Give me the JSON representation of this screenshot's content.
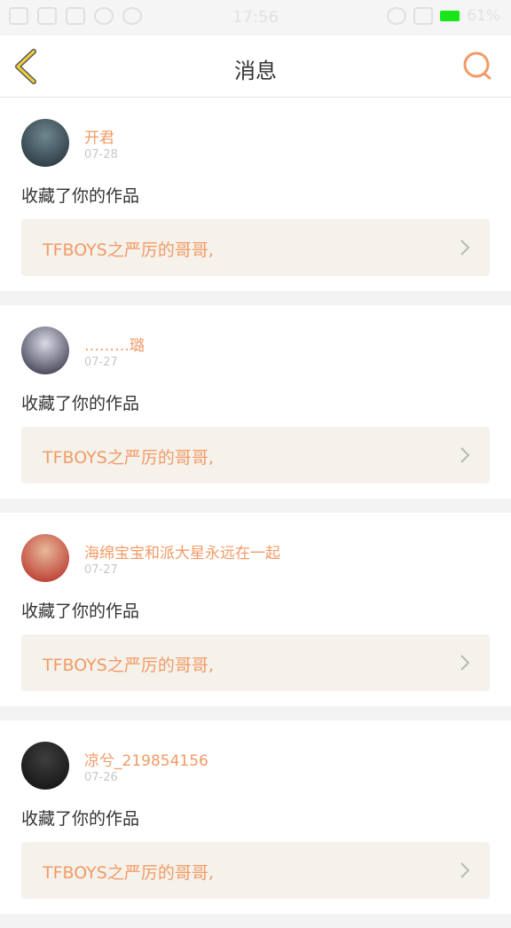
{
  "status_bar": {
    "time": "17:56",
    "battery_percent": "61%",
    "icons_left": [
      "usb-icon",
      "signal-icon",
      "image-icon",
      "shield-icon",
      "broadcast-icon"
    ],
    "icons_right": [
      "hotspot-icon",
      "wifi-icon",
      "battery-icon"
    ],
    "battery_color": "#19e619"
  },
  "header": {
    "title": "消息",
    "back_icon": "chevron-left-icon",
    "search_icon": "search-icon",
    "accent_color": "#f39a66"
  },
  "messages": [
    {
      "username": "开君",
      "date": "07-28",
      "action": "收藏了你的作品",
      "work_title": "TFBOYS之严厉的哥哥,",
      "avatar_colors": [
        "#6f8790",
        "#1f2c33"
      ]
    },
    {
      "username": "………璐",
      "date": "07-27",
      "action": "收藏了你的作品",
      "work_title": "TFBOYS之严厉的哥哥,",
      "avatar_colors": [
        "#d9d9e6",
        "#27273a"
      ]
    },
    {
      "username": "海绵宝宝和派大星永远在一起",
      "date": "07-27",
      "action": "收藏了你的作品",
      "work_title": "TFBOYS之严厉的哥哥,",
      "avatar_colors": [
        "#e8b89a",
        "#b3261e"
      ]
    },
    {
      "username": "凉兮_219854156",
      "date": "07-26",
      "action": "收藏了你的作品",
      "work_title": "TFBOYS之严厉的哥哥,",
      "avatar_colors": [
        "#3e3e3e",
        "#0e0e0e"
      ]
    }
  ]
}
